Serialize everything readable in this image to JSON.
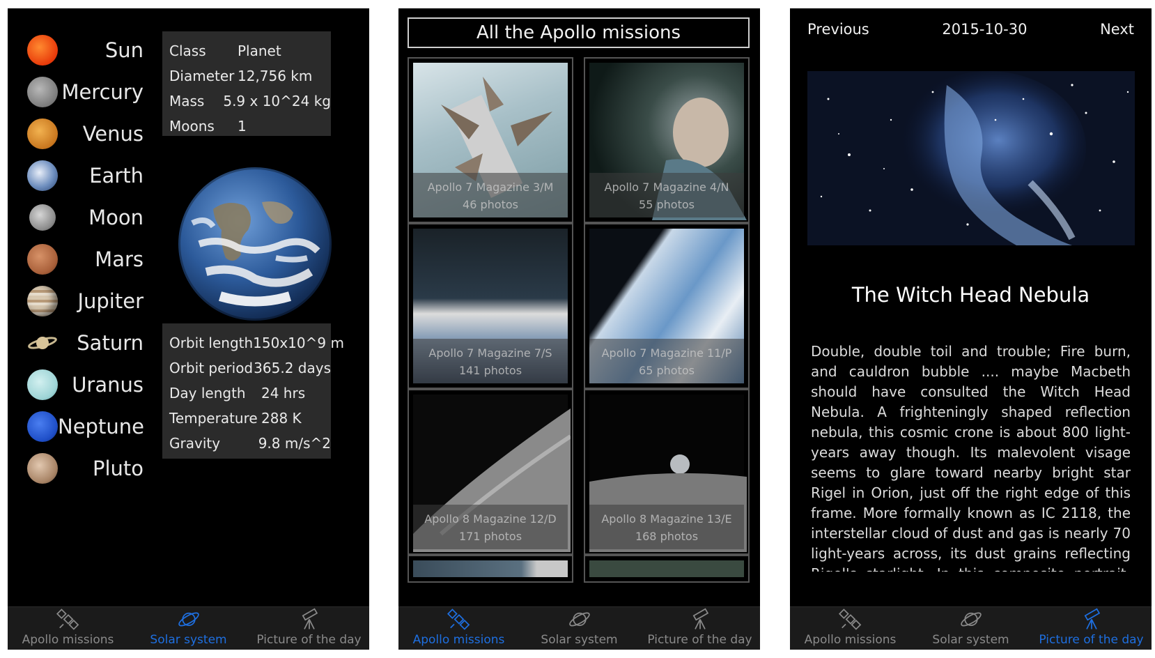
{
  "solar": {
    "planets": [
      "Sun",
      "Mercury",
      "Venus",
      "Earth",
      "Moon",
      "Mars",
      "Jupiter",
      "Saturn",
      "Uranus",
      "Neptune",
      "Pluto"
    ],
    "info_top": [
      {
        "k": "Class",
        "v": "Planet"
      },
      {
        "k": "Diameter",
        "v": "12,756 km"
      },
      {
        "k": "Mass",
        "v": "5.9 x 10^24 kg"
      },
      {
        "k": "Moons",
        "v": "1"
      }
    ],
    "info_bottom": [
      {
        "k": "Orbit length",
        "v": "150x10^9 m"
      },
      {
        "k": "Orbit period",
        "v": "365.2 days"
      },
      {
        "k": "Day length",
        "v": "24 hrs"
      },
      {
        "k": "Temperature",
        "v": "288 K"
      },
      {
        "k": "Gravity",
        "v": "9.8 m/s^2"
      }
    ]
  },
  "apollo": {
    "title": "All the Apollo missions",
    "items": [
      {
        "name": "Apollo 7 Magazine 3/M",
        "count": "46 photos"
      },
      {
        "name": "Apollo 7 Magazine 4/N",
        "count": "55 photos"
      },
      {
        "name": "Apollo 7 Magazine 7/S",
        "count": "141 photos"
      },
      {
        "name": "Apollo 7 Magazine 11/P",
        "count": "65 photos"
      },
      {
        "name": "Apollo 8 Magazine 12/D",
        "count": "171 photos"
      },
      {
        "name": "Apollo 8 Magazine 13/E",
        "count": "168 photos"
      }
    ]
  },
  "potd": {
    "prev": "Previous",
    "date": "2015-10-30",
    "next": "Next",
    "title": "The Witch Head Nebula",
    "body": "Double, double toil and trouble; Fire burn, and cauldron bubble .... maybe Macbeth should have consulted the Witch Head Nebula. A frighteningly shaped reflection nebula, this cosmic crone is about 800 light-years away though. Its malevolent visage seems to glare toward nearby bright star Rigel in Orion, just off the right edge of this frame. More formally known as IC 2118, the interstellar cloud of dust and gas is nearly 70 light-years across, its dust grains reflecting Rigel's starlight. In this composite portrait, the nebula's color is caused not only by the star's intense bluish light but"
  },
  "tabs": {
    "apollo": "Apollo missions",
    "solar": "Solar system",
    "potd": "Picture of the day"
  },
  "colors": {
    "active_tab": "#1e6fe0",
    "inactive_tab": "#8a8a8a",
    "panel_bg": "#000000",
    "info_bg": "#2b2b2b"
  },
  "icons": [
    "satellite-icon",
    "planet-icon",
    "telescope-icon"
  ]
}
